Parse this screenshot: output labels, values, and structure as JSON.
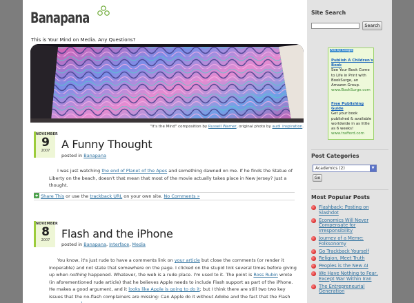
{
  "site": {
    "logo_text": "Banapana",
    "tagline": "This is Your Mind on Media. Any Questions?"
  },
  "banner": {
    "caption_prefix": "\"It's the Mind\" composition by ",
    "caption_author": "Russell Warner",
    "caption_mid": ", original photo by ",
    "caption_photographer": "audi_inspiration",
    "caption_suffix": "."
  },
  "posts": [
    {
      "month": "NOVEMBER",
      "day": "9",
      "year": "2007",
      "title": "A Funny Thought",
      "posted_in": "posted in",
      "categories": [
        "Banapana"
      ],
      "body_1": "I was just watching ",
      "body_link": "the end of Planet of the Apes",
      "body_2": " and something dawned on me. If he finds the Statue of Liberty on the beach, doesn't that mean that most of the movie actually takes place in New Jersey? Just a thought.",
      "share_label": "Share This",
      "share_mid": " or use the ",
      "trackback_label": "trackback URL",
      "share_end": " on your own site. ",
      "comments_label": "No Comments »"
    },
    {
      "month": "NOVEMBER",
      "day": "8",
      "year": "2007",
      "title": "Flash and the iPhone",
      "posted_in": "posted in",
      "categories": [
        "Banapana",
        "Interface",
        "Media"
      ],
      "body_a": "You know, it's just rude to have a comments link on ",
      "body_link_1": "your article",
      "body_b": " but close the comments (or render it inoperable) and not state that somewhere on the page. I clicked on the stupid link several times before giving up when ",
      "body_em": "nothing",
      "body_c": " happened. Whatever, the web is a rude place. I'm used to it. The point is ",
      "body_link_2": "Ross Rubin",
      "body_d": " wrote (in aforementioned rude article) that he believes Apple needs to include Flash support as part of the iPhone. He makes a good argument, and it ",
      "body_link_3": "looks like Apple is going to do it",
      "body_e": "; but I think there are still two two key issues that the no-flash complainers are missing: Can Apple do it without Adobe and the fact that the Flash plugin is crap.",
      "body_sup": "1"
    }
  ],
  "sidebar": {
    "search_heading": "Site Search",
    "search_value": "",
    "search_button": "Search",
    "ads_label": "Ads by Google",
    "ads": [
      {
        "title": "Publish A Children's Book",
        "text": "See Your Book Come to Life in Print with BookSurge, an Amazon Group.",
        "url": "www.BookSurge.com"
      },
      {
        "title": "Free Publishing Guide",
        "text": "Get your book published & available worldwide in as little as 6 weeks!",
        "url": "www.trafford.com"
      }
    ],
    "categories_heading": "Post Categories",
    "category_selected": "Academics  (2)",
    "go_button": "Go",
    "popular_heading": "Most Popular Posts",
    "popular": [
      "Flashback: Posting on Slashdot",
      "Economics Will Never Compensate for Irresponsibility",
      "Journey of a Meme: Folksonomy",
      "Go Trackback Yourself",
      "Religion, Meet Truth",
      "Peoples is the New AI",
      "We Have Nothing to Fear, Except War Within Iran",
      "The Entrepreneurial Generation"
    ]
  },
  "colors": {
    "page_bg": "#7d7d7d",
    "sidebar_bg": "#e3e3e3",
    "link": "#2b6f9e",
    "date_accent": "#9ccc3b",
    "ads_green": "#9cd36b",
    "bullet_red": "#c40000"
  },
  "icons": [
    "logo-mark-icon",
    "share-icon",
    "select-arrow-icon",
    "bullet-icon"
  ]
}
